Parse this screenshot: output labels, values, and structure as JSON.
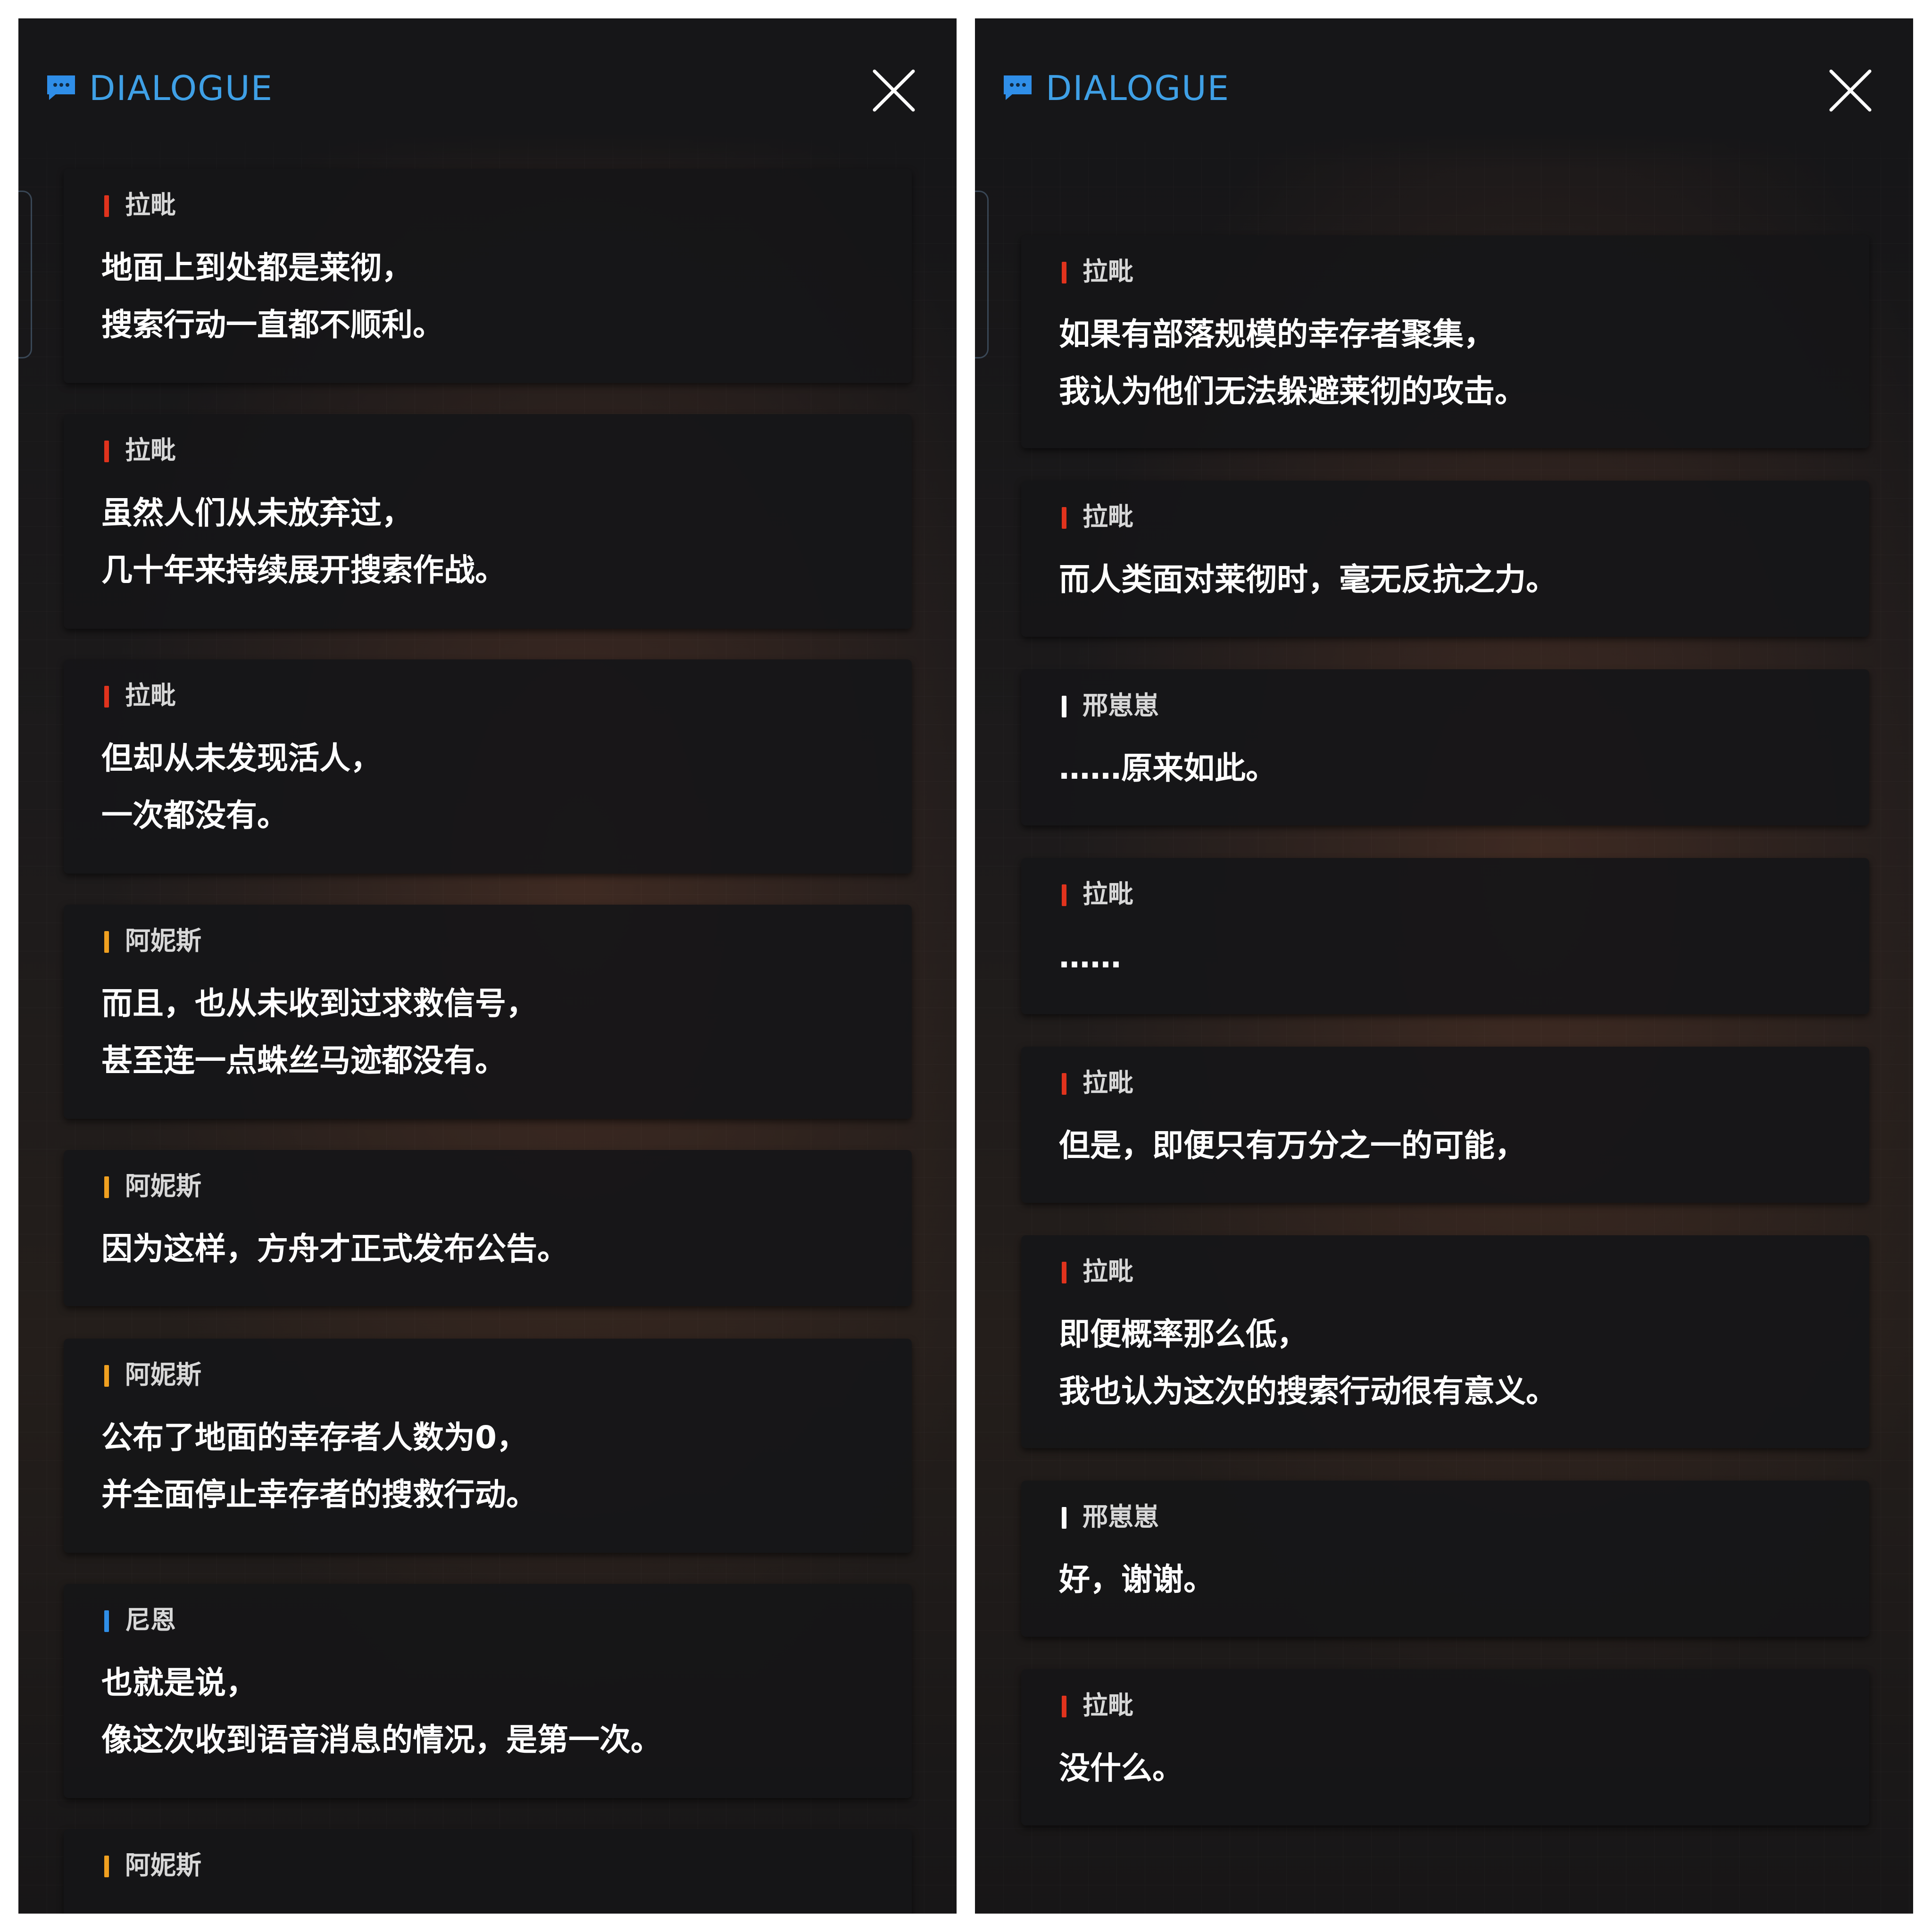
{
  "left": {
    "header": {
      "title": "DIALOGUE"
    },
    "cards": [
      {
        "speaker": "拉毗",
        "color": "#e0331d",
        "lines": [
          "地面上到处都是莱彻，",
          "搜索行动一直都不顺利。"
        ]
      },
      {
        "speaker": "拉毗",
        "color": "#e0331d",
        "lines": [
          "虽然人们从未放弃过，",
          "几十年来持续展开搜索作战。"
        ]
      },
      {
        "speaker": "拉毗",
        "color": "#e0331d",
        "lines": [
          "但却从未发现活人，",
          "一次都没有。"
        ]
      },
      {
        "speaker": "阿妮斯",
        "color": "#f0a020",
        "lines": [
          "而且，也从未收到过求救信号，",
          "甚至连一点蛛丝马迹都没有。"
        ]
      },
      {
        "speaker": "阿妮斯",
        "color": "#f0a020",
        "lines": [
          "因为这样，方舟才正式发布公告。"
        ]
      },
      {
        "speaker": "阿妮斯",
        "color": "#f0a020",
        "lines": [
          "公布了地面的幸存者人数为0，",
          "并全面停止幸存者的搜救行动。"
        ]
      },
      {
        "speaker": "尼恩",
        "color": "#2f8ee8",
        "lines": [
          "也就是说，",
          "像这次收到语音消息的情况，是第一次。"
        ]
      },
      {
        "speaker": "阿妮斯",
        "color": "#f0a020",
        "lines": []
      }
    ]
  },
  "right": {
    "header": {
      "title": "DIALOGUE"
    },
    "cards": [
      {
        "speaker": "拉毗",
        "color": "#e0331d",
        "lines": [
          "如果有部落规模的幸存者聚集，",
          "我认为他们无法躲避莱彻的攻击。"
        ]
      },
      {
        "speaker": "拉毗",
        "color": "#e0331d",
        "lines": [
          "而人类面对莱彻时，毫无反抗之力。"
        ]
      },
      {
        "speaker": "邢崽崽",
        "color": "#ffffff",
        "lines": [
          "……原来如此。"
        ]
      },
      {
        "speaker": "拉毗",
        "color": "#e0331d",
        "lines": [
          "……"
        ]
      },
      {
        "speaker": "拉毗",
        "color": "#e0331d",
        "lines": [
          "但是，即便只有万分之一的可能，"
        ]
      },
      {
        "speaker": "拉毗",
        "color": "#e0331d",
        "lines": [
          "即便概率那么低，",
          "我也认为这次的搜索行动很有意义。"
        ]
      },
      {
        "speaker": "邢崽崽",
        "color": "#ffffff",
        "lines": [
          "好，谢谢。"
        ]
      },
      {
        "speaker": "拉毗",
        "color": "#e0331d",
        "lines": [
          "没什么。"
        ]
      }
    ]
  }
}
